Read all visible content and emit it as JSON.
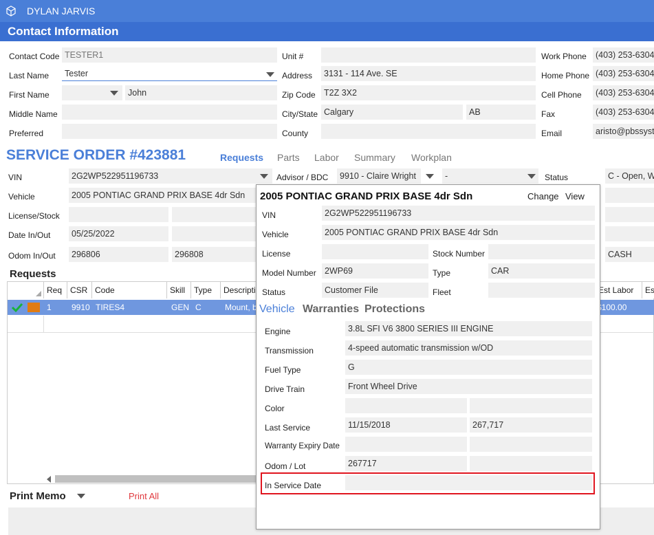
{
  "app": {
    "user_name": "DYLAN JARVIS",
    "section_title": "Contact Information"
  },
  "contact": {
    "contact_code_label": "Contact Code",
    "contact_code": "TESTER1",
    "last_name_label": "Last Name",
    "last_name": "Tester",
    "first_name_label": "First Name",
    "first_name": "John",
    "middle_name_label": "Middle Name",
    "middle_name": "",
    "preferred_label": "Preferred",
    "preferred": "",
    "unit_label": "Unit #",
    "unit": "",
    "address_label": "Address",
    "address": "3131 - 114 Ave. SE",
    "zip_label": "Zip Code",
    "zip": "T2Z 3X2",
    "citystate_label": "City/State",
    "city": "Calgary",
    "state": "AB",
    "county_label": "County",
    "county": "",
    "work_phone_label": "Work Phone",
    "work_phone": "(403) 253-6304",
    "home_phone_label": "Home Phone",
    "home_phone": "(403) 253-6304",
    "cell_phone_label": "Cell Phone",
    "cell_phone": "(403) 253-6304",
    "fax_label": "Fax",
    "fax": "(403) 253-6304",
    "email_label": "Email",
    "email": "aristo@pbssystems"
  },
  "service_order": {
    "title": "SERVICE ORDER #423881",
    "tabs": [
      "Requests",
      "Parts",
      "Labor",
      "Summary",
      "Workplan"
    ],
    "vin_label": "VIN",
    "vin": "2G2WP522951196733",
    "vehicle_label": "Vehicle",
    "vehicle": "2005 PONTIAC GRAND PRIX BASE 4dr Sdn",
    "license_label": "License/Stock",
    "date_label": "Date In/Out",
    "date_in": "05/25/2022",
    "odom_label": "Odom In/Out",
    "odom_in": "296806",
    "odom_out": "296808",
    "advisor_label": "Advisor / BDC",
    "advisor": "9910 - Claire Wright",
    "bdc": "-",
    "status_label": "Status",
    "status": "C - Open, Wai",
    "pay_type": "CASH"
  },
  "requests": {
    "title": "Requests",
    "columns": [
      "Req",
      "CSR",
      "Code",
      "Skill",
      "Type",
      "Description",
      "Est Labor",
      "Es"
    ],
    "row": {
      "req": "1",
      "csr": "9910",
      "code": "TIRES4",
      "skill": "GEN",
      "type": "C",
      "description": "Mount, b",
      "est_labor": "$100.00"
    }
  },
  "print_memo": {
    "label": "Print Memo",
    "print_all": "Print All"
  },
  "popup": {
    "title": "2005 PONTIAC GRAND PRIX BASE 4dr Sdn",
    "change": "Change",
    "view": "View",
    "vin_label": "VIN",
    "vin": "2G2WP522951196733",
    "vehicle_label": "Vehicle",
    "vehicle": "2005 PONTIAC GRAND PRIX BASE 4dr Sdn",
    "license_label": "License",
    "license": "",
    "stock_label": "Stock Number",
    "stock": "",
    "model_label": "Model Number",
    "model": "2WP69",
    "type_label": "Type",
    "type": "CAR",
    "status_label": "Status",
    "status": "Customer File",
    "fleet_label": "Fleet",
    "fleet": "",
    "tabs": [
      "Vehicle",
      "Warranties",
      "Protections"
    ],
    "engine_label": "Engine",
    "engine": "3.8L SFI V6 3800 SERIES III ENGINE",
    "transmission_label": "Transmission",
    "transmission": "4-speed automatic transmission w/OD",
    "fuel_label": "Fuel Type",
    "fuel": "G",
    "drive_label": "Drive Train",
    "drive": "Front Wheel Drive",
    "color_label": "Color",
    "color": "",
    "last_service_label": "Last Service",
    "last_service_date": "11/15/2018",
    "last_service_odom": "267,717",
    "warranty_label": "Warranty Expiry Date",
    "odom_lot_label": "Odom / Lot",
    "odom": "267717",
    "in_service_label": "In Service Date",
    "in_service": ""
  },
  "colors": {
    "accent": "#4a7fd8",
    "selected_row": "#6f97df",
    "highlight_box": "#e0141e",
    "print_all": "#e0393e"
  }
}
